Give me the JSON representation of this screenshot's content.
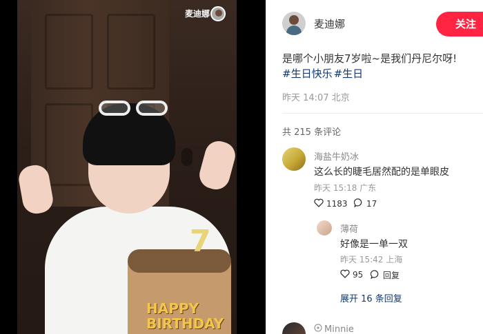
{
  "video": {
    "author_name": "麦迪娜",
    "cake_candle": "7",
    "cake_text_line1": "HAPPY",
    "cake_text_line2": "BIRTHDAY"
  },
  "author": {
    "name": "麦迪娜",
    "follow_label": "关注"
  },
  "post": {
    "text": "是哪个小朋友7岁啦~是我们丹尼尔呀!",
    "tags": [
      "#生日快乐",
      "#生日"
    ],
    "time": "昨天 14:07 北京"
  },
  "comments_header": {
    "count_text": "共 215 条评论"
  },
  "comments": [
    {
      "name": "海盐牛奶冰",
      "text": "这么长的睫毛居然配的是单眼皮",
      "meta": "昨天 15:18 广东",
      "likes": "1183",
      "replies_count": "17",
      "reply": {
        "name": "薄荷",
        "text": "好像是一单一双",
        "meta": "昨天 15:42 上海",
        "likes": "95",
        "reply_label": "回复"
      },
      "expand_label": "展开 16 条回复"
    },
    {
      "name": "Minnie"
    }
  ],
  "icons": {
    "heart": "heart-icon",
    "comment": "comment-icon"
  },
  "colors": {
    "accent": "#ff2442",
    "tag": "#13386c"
  }
}
